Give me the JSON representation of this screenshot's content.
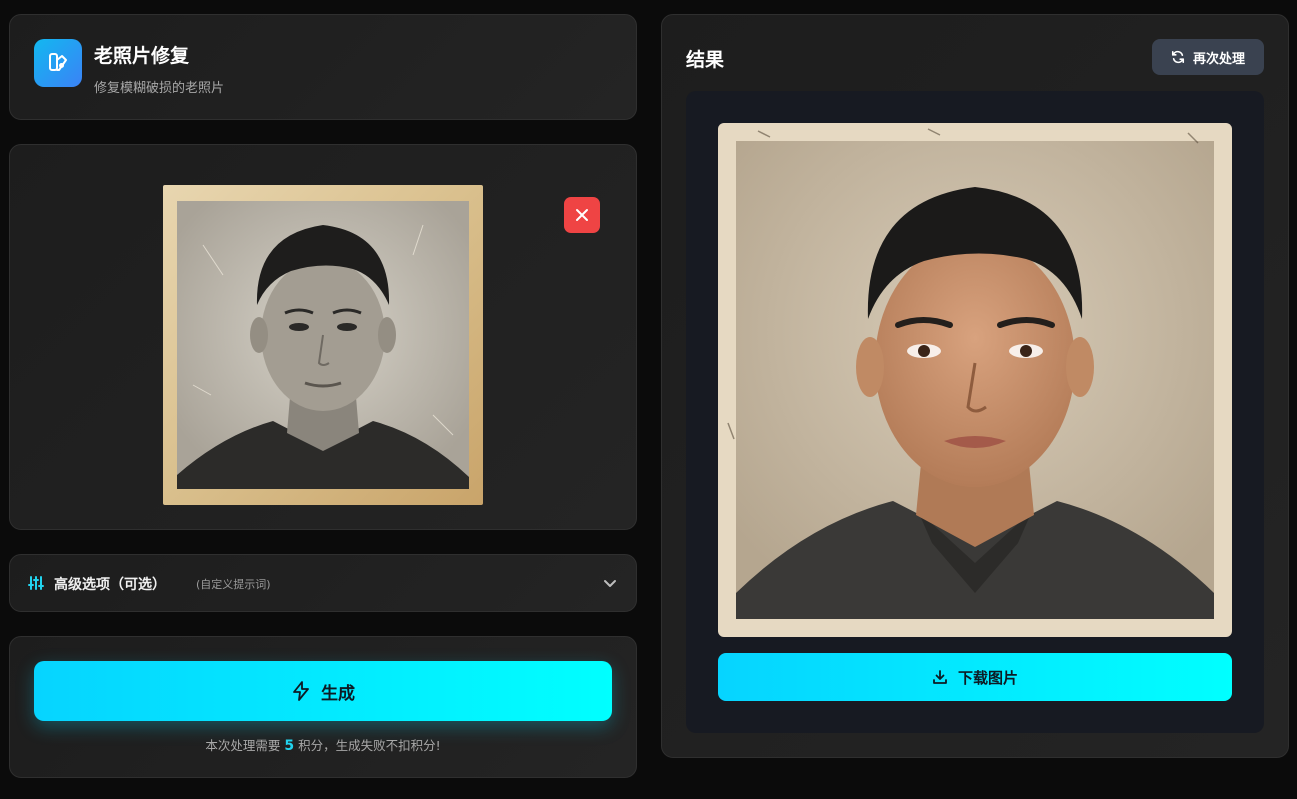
{
  "header": {
    "icon": "photo-restore-icon",
    "title": "老照片修复",
    "subtitle": "修复模糊破损的老照片"
  },
  "upload": {
    "image_alt": "uploaded old black-and-white portrait photo",
    "remove_icon": "close-icon"
  },
  "advanced": {
    "icon": "sliders-icon",
    "label": "高级选项（可选）",
    "hint": "(自定义提示词)",
    "chevron_icon": "chevron-down-icon"
  },
  "generate": {
    "icon": "lightning-icon",
    "label": "生成",
    "note_prefix": "本次处理需要",
    "credits": "5",
    "note_suffix": "积分，生成失败不扣积分!"
  },
  "result": {
    "title": "结果",
    "reprocess_icon": "refresh-icon",
    "reprocess_label": "再次处理",
    "image_alt": "restored colorized portrait photo",
    "download_icon": "download-icon",
    "download_label": "下载图片"
  },
  "colors": {
    "accent_cyan": "#00e5ff",
    "danger_red": "#ef4444",
    "icon_gradient_start": "#12b8f0",
    "icon_gradient_end": "#3b82f6"
  }
}
